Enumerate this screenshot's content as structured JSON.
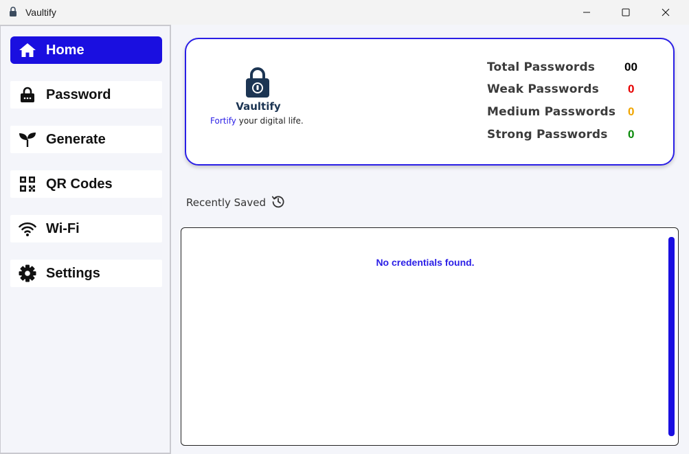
{
  "window": {
    "title": "Vaultify"
  },
  "sidebar": {
    "items": [
      {
        "label": "Home",
        "icon": "home-icon",
        "active": true
      },
      {
        "label": "Password",
        "icon": "lock-icon"
      },
      {
        "label": "Generate",
        "icon": "sprout-icon"
      },
      {
        "label": "QR Codes",
        "icon": "qr-code-icon"
      },
      {
        "label": "Wi-Fi",
        "icon": "wifi-icon"
      },
      {
        "label": "Settings",
        "icon": "gear-icon"
      }
    ]
  },
  "brand": {
    "name": "Vaultify",
    "tagline_accent": "Fortify",
    "tagline_rest": " your digital life."
  },
  "stats": [
    {
      "label": "Total Passwords",
      "value": "00",
      "color": "#000000"
    },
    {
      "label": "Weak Passwords",
      "value": "0",
      "color": "#e60000"
    },
    {
      "label": "Medium Passwords",
      "value": "0",
      "color": "#f0a500"
    },
    {
      "label": "Strong Passwords",
      "value": "0",
      "color": "#0a8a0a"
    }
  ],
  "recent": {
    "title": "Recently Saved",
    "empty_message": "No credentials found."
  },
  "colors": {
    "accent": "#1a0fe0",
    "background": "#f4f5fa"
  }
}
